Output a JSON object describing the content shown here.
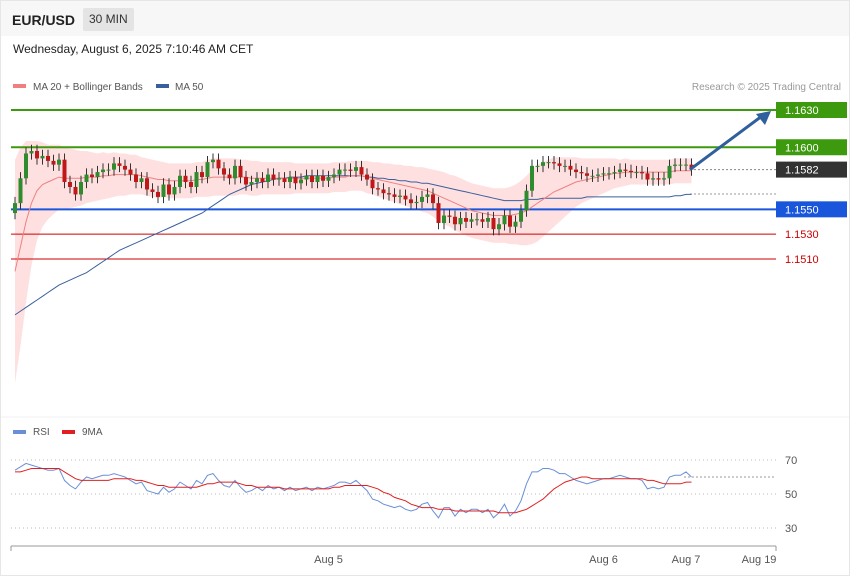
{
  "header": {
    "symbol": "EUR/USD",
    "timeframe": "30 MIN",
    "datetime": "Wednesday, August 6, 2025 7:10:46 AM CET"
  },
  "legend": {
    "ma20": "MA 20 + Bollinger Bands",
    "ma50": "MA 50",
    "credit": "Research © 2025 Trading Central",
    "colors": {
      "ma20": "#f08080",
      "ma50": "#3a5f9f",
      "band": "#ffd6d6"
    }
  },
  "levels": [
    {
      "value": 1.163,
      "label": "1.1630",
      "kind": "resistance",
      "color": "#3d9a0e"
    },
    {
      "value": 1.16,
      "label": "1.1600",
      "kind": "resistance",
      "color": "#3d9a0e"
    },
    {
      "value": 1.1582,
      "label": "1.1582",
      "kind": "current",
      "color": "#333333"
    },
    {
      "value": 1.155,
      "label": "1.1550",
      "kind": "pivot",
      "color": "#1a56db"
    },
    {
      "value": 1.153,
      "label": "1.1530",
      "kind": "support",
      "color": "#cc0000"
    },
    {
      "value": 1.151,
      "label": "1.1510",
      "kind": "support",
      "color": "#cc0000"
    }
  ],
  "xaxis": {
    "labels": [
      {
        "text": "Aug 5",
        "index": 57
      },
      {
        "text": "Aug 6",
        "index": 107
      },
      {
        "text": "Aug 7",
        "index": 122
      },
      {
        "text": "Aug 19",
        "index": 132
      }
    ]
  },
  "rsi": {
    "legend_rsi": "RSI",
    "legend_ma": "9MA",
    "colors": {
      "rsi": "#6a8fd8",
      "ma": "#e02020"
    },
    "ticks": [
      {
        "value": 70,
        "label": "70"
      },
      {
        "value": 50,
        "label": "50"
      },
      {
        "value": 30,
        "label": "30"
      }
    ]
  },
  "chart_data": {
    "type": "candlestick",
    "price_range": [
      1.14,
      1.164
    ],
    "close": [
      1.1555,
      1.1575,
      1.1595,
      1.1597,
      1.1591,
      1.1593,
      1.1589,
      1.1586,
      1.159,
      1.1572,
      1.1568,
      1.1562,
      1.1572,
      1.1578,
      1.1576,
      1.158,
      1.1582,
      1.1582,
      1.1587,
      1.1585,
      1.1582,
      1.1578,
      1.1572,
      1.1575,
      1.1566,
      1.1564,
      1.156,
      1.157,
      1.1562,
      1.1568,
      1.1577,
      1.1572,
      1.1568,
      1.158,
      1.1576,
      1.1588,
      1.159,
      1.1583,
      1.1578,
      1.1575,
      1.1585,
      1.1576,
      1.157,
      1.1572,
      1.1575,
      1.1572,
      1.1578,
      1.1574,
      1.1575,
      1.1572,
      1.1576,
      1.1571,
      1.1574,
      1.1577,
      1.1572,
      1.1577,
      1.1573,
      1.1576,
      1.1578,
      1.1582,
      1.1582,
      1.1581,
      1.1584,
      1.1578,
      1.1574,
      1.1567,
      1.1566,
      1.1563,
      1.1562,
      1.156,
      1.1561,
      1.1558,
      1.1555,
      1.1556,
      1.156,
      1.1562,
      1.1555,
      1.1539,
      1.1545,
      1.1544,
      1.1538,
      1.1543,
      1.154,
      1.1542,
      1.1542,
      1.154,
      1.1543,
      1.1534,
      1.1538,
      1.1545,
      1.1536,
      1.154,
      1.1549,
      1.1565,
      1.1585,
      1.1585,
      1.1588,
      1.1588,
      1.1587,
      1.1585,
      1.1585,
      1.1582,
      1.158,
      1.1579,
      1.1577,
      1.1577,
      1.1578,
      1.1579,
      1.1579,
      1.158,
      1.1582,
      1.1581,
      1.158,
      1.158,
      1.1579,
      1.1574,
      1.1575,
      1.1574,
      1.1575,
      1.1585,
      1.1586,
      1.1586,
      1.1586,
      1.1582
    ],
    "open_offsets": "derived",
    "ma20": [
      1.15,
      1.152,
      1.154,
      1.1555,
      1.1565,
      1.157,
      1.1572,
      1.1574,
      1.1576,
      1.1575,
      1.1575,
      1.1575,
      1.1575,
      1.1576,
      1.1576,
      1.1576,
      1.1577,
      1.1577,
      1.1578,
      1.1578,
      1.1578,
      1.1578,
      1.1578,
      1.1577,
      1.1576,
      1.1575,
      1.1574,
      1.1574,
      1.1573,
      1.1573,
      1.1573,
      1.1573,
      1.1573,
      1.1574,
      1.1574,
      1.1575,
      1.1576,
      1.1576,
      1.1576,
      1.1576,
      1.1576,
      1.1576,
      1.1576,
      1.1575,
      1.1575,
      1.1575,
      1.1575,
      1.1575,
      1.1575,
      1.1575,
      1.1575,
      1.1575,
      1.1575,
      1.1575,
      1.1575,
      1.1575,
      1.1575,
      1.1575,
      1.1576,
      1.1576,
      1.1576,
      1.1577,
      1.1577,
      1.1577,
      1.1576,
      1.1575,
      1.1574,
      1.1573,
      1.1572,
      1.1571,
      1.157,
      1.1569,
      1.1568,
      1.1567,
      1.1566,
      1.1565,
      1.1563,
      1.1561,
      1.1559,
      1.1557,
      1.1555,
      1.1553,
      1.1551,
      1.1549,
      1.1548,
      1.1547,
      1.1546,
      1.1545,
      1.1545,
      1.1545,
      1.1545,
      1.1546,
      1.1547,
      1.1549,
      1.1552,
      1.1555,
      1.1558,
      1.1561,
      1.1564,
      1.1566,
      1.1568,
      1.157,
      1.1572,
      1.1573,
      1.1574,
      1.1575,
      1.1576,
      1.1577,
      1.1578,
      1.1579,
      1.1579,
      1.158,
      1.158,
      1.158,
      1.158,
      1.158,
      1.158,
      1.158,
      1.158,
      1.158,
      1.1581,
      1.1581,
      1.1581,
      1.1581
    ],
    "ma50": [
      1.1465,
      1.1468,
      1.1471,
      1.1474,
      1.1477,
      1.148,
      1.1483,
      1.1486,
      1.1489,
      1.1491,
      1.1493,
      1.1495,
      1.1497,
      1.1499,
      1.1502,
      1.1505,
      1.1508,
      1.1511,
      1.1514,
      1.1517,
      1.1519,
      1.1521,
      1.1523,
      1.1525,
      1.1527,
      1.1529,
      1.1531,
      1.1533,
      1.1535,
      1.1537,
      1.1539,
      1.1541,
      1.1543,
      1.1545,
      1.1547,
      1.155,
      1.1553,
      1.1556,
      1.1559,
      1.1562,
      1.1564,
      1.1566,
      1.1568,
      1.157,
      1.1571,
      1.1572,
      1.1573,
      1.1574,
      1.1575,
      1.1575,
      1.1576,
      1.1576,
      1.1576,
      1.1577,
      1.1577,
      1.1577,
      1.1577,
      1.1577,
      1.1577,
      1.1577,
      1.1577,
      1.1577,
      1.1577,
      1.1577,
      1.1576,
      1.1576,
      1.1575,
      1.1575,
      1.1574,
      1.1574,
      1.1573,
      1.1573,
      1.1572,
      1.1572,
      1.1571,
      1.1571,
      1.157,
      1.1569,
      1.1568,
      1.1567,
      1.1566,
      1.1565,
      1.1564,
      1.1563,
      1.1562,
      1.1561,
      1.156,
      1.1559,
      1.1558,
      1.1557,
      1.1557,
      1.1557,
      1.1557,
      1.1558,
      1.1558,
      1.1558,
      1.1559,
      1.1559,
      1.1559,
      1.1559,
      1.1559,
      1.1559,
      1.1559,
      1.1559,
      1.156,
      1.156,
      1.156,
      1.156,
      1.156,
      1.156,
      1.156,
      1.156,
      1.156,
      1.156,
      1.156,
      1.156,
      1.156,
      1.156,
      1.156,
      1.156,
      1.1561,
      1.1561,
      1.1562,
      1.1562
    ],
    "band_width": [
      0.009,
      0.008,
      0.0065,
      0.005,
      0.004,
      0.0034,
      0.003,
      0.0028,
      0.0026,
      0.0025,
      0.0024,
      0.0023,
      0.0022,
      0.0021,
      0.002,
      0.0019,
      0.0019,
      0.0018,
      0.0018,
      0.0017,
      0.0017,
      0.0016,
      0.0016,
      0.0015,
      0.0015,
      0.0015,
      0.0015,
      0.0014,
      0.0014,
      0.0014,
      0.0014,
      0.0014,
      0.0014,
      0.0014,
      0.0014,
      0.0015,
      0.0015,
      0.0015,
      0.0015,
      0.0015,
      0.0015,
      0.0014,
      0.0014,
      0.0014,
      0.0014,
      0.0013,
      0.0013,
      0.0013,
      0.0013,
      0.0013,
      0.0013,
      0.0012,
      0.0012,
      0.0012,
      0.0012,
      0.0012,
      0.0012,
      0.0012,
      0.0012,
      0.0012,
      0.0012,
      0.0012,
      0.0012,
      0.0012,
      0.0013,
      0.0013,
      0.0014,
      0.0014,
      0.0015,
      0.0015,
      0.0016,
      0.0016,
      0.0017,
      0.0017,
      0.0018,
      0.0018,
      0.0019,
      0.002,
      0.0021,
      0.0021,
      0.0022,
      0.0022,
      0.0022,
      0.0022,
      0.0022,
      0.0022,
      0.0022,
      0.0022,
      0.0022,
      0.0022,
      0.0023,
      0.0024,
      0.0026,
      0.0028,
      0.003,
      0.0031,
      0.003,
      0.0029,
      0.0028,
      0.0026,
      0.0024,
      0.0022,
      0.002,
      0.0018,
      0.0017,
      0.0016,
      0.0015,
      0.0014,
      0.0013,
      0.0012,
      0.0011,
      0.0011,
      0.001,
      0.001,
      0.001,
      0.001,
      0.001,
      0.001,
      0.001,
      0.001,
      0.001,
      0.001,
      0.001,
      0.001
    ],
    "projection": {
      "from_value": 1.1582,
      "to_value": 1.163
    },
    "rsi_values": [
      64,
      66,
      68,
      67,
      66,
      65,
      64,
      64,
      65,
      58,
      55,
      53,
      57,
      60,
      59,
      60,
      61,
      61,
      62,
      61,
      60,
      58,
      56,
      57,
      52,
      51,
      50,
      54,
      51,
      53,
      57,
      55,
      53,
      58,
      56,
      61,
      62,
      58,
      55,
      54,
      58,
      54,
      51,
      52,
      54,
      52,
      55,
      53,
      54,
      52,
      54,
      52,
      53,
      54,
      52,
      54,
      53,
      54,
      55,
      57,
      57,
      56,
      58,
      55,
      52,
      47,
      46,
      44,
      43,
      42,
      43,
      41,
      40,
      41,
      44,
      45,
      40,
      36,
      42,
      42,
      37,
      41,
      39,
      41,
      41,
      39,
      41,
      36,
      39,
      44,
      37,
      40,
      46,
      56,
      63,
      63,
      65,
      65,
      64,
      62,
      62,
      60,
      58,
      57,
      56,
      57,
      58,
      59,
      59,
      60,
      61,
      60,
      59,
      59,
      58,
      53,
      54,
      53,
      54,
      60,
      61,
      61,
      63,
      60
    ],
    "rsi_ma": [
      63,
      63,
      64,
      65,
      65,
      65,
      65,
      65,
      65,
      63,
      61,
      59,
      58,
      58,
      58,
      58,
      58,
      58,
      59,
      59,
      59,
      59,
      58,
      58,
      57,
      56,
      55,
      55,
      54,
      54,
      54,
      54,
      54,
      54,
      55,
      56,
      56,
      57,
      57,
      57,
      57,
      56,
      55,
      55,
      54,
      54,
      54,
      54,
      54,
      53,
      53,
      53,
      53,
      53,
      53,
      53,
      53,
      53,
      54,
      54,
      55,
      55,
      55,
      55,
      55,
      54,
      53,
      51,
      50,
      48,
      47,
      46,
      44,
      43,
      42,
      42,
      42,
      41,
      41,
      41,
      40,
      40,
      40,
      40,
      40,
      40,
      40,
      40,
      39,
      39,
      39,
      39,
      40,
      41,
      43,
      45,
      47,
      50,
      53,
      55,
      57,
      58,
      59,
      60,
      60,
      59,
      59,
      59,
      59,
      59,
      59,
      59,
      59,
      59,
      59,
      58,
      58,
      57,
      56,
      56,
      56,
      56,
      57,
      57
    ]
  }
}
